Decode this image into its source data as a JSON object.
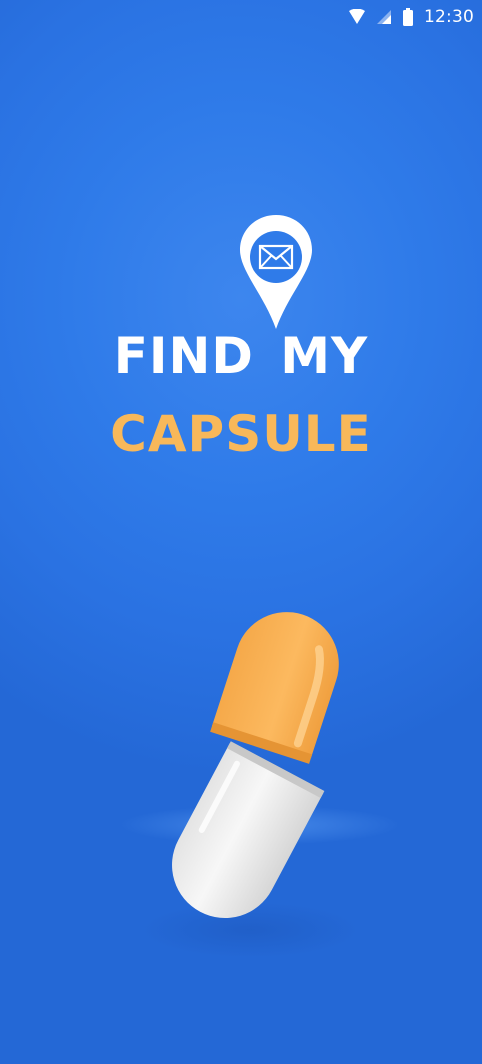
{
  "status_bar": {
    "time": "12:30",
    "icons": [
      "wifi-icon",
      "cellular-signal-icon",
      "battery-icon"
    ]
  },
  "logo": {
    "icon": "location-pin-mail-icon",
    "line1": "FIND MY",
    "line2": "CAPSULE"
  },
  "illustration": {
    "icon": "capsule-pill-icon"
  },
  "colors": {
    "background": "#2f7be9",
    "accent": "#f8b85a",
    "text": "#ffffff"
  }
}
